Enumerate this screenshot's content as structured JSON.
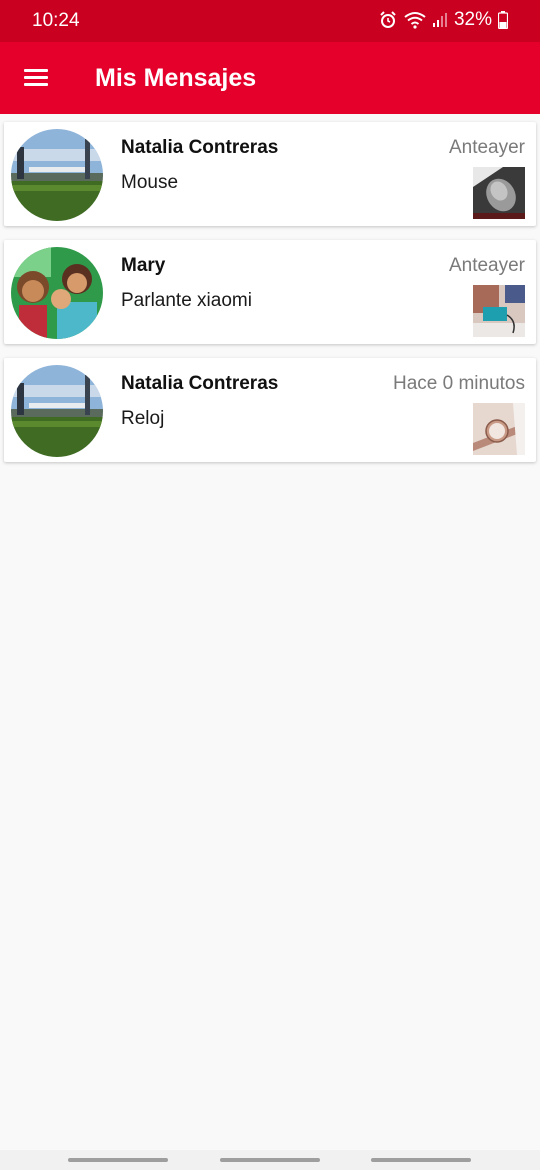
{
  "status": {
    "time": "10:24",
    "battery": "32%",
    "icons": [
      "alarm-icon",
      "wifi-icon",
      "signal-icon",
      "battery-icon"
    ]
  },
  "header": {
    "title": "Mis Mensajes",
    "menu_icon": "hamburger-menu-icon"
  },
  "colors": {
    "primary": "#e4002b",
    "status_bar": "#c9001f",
    "background": "#f9f9f9"
  },
  "conversations": [
    {
      "name": "Natalia Contreras",
      "time": "Anteayer",
      "message": "Mouse",
      "avatar": "avatar-photo-outdoor",
      "thumb": "mouse-product-thumbnail"
    },
    {
      "name": "Mary",
      "time": "Anteayer",
      "message": "Parlante xiaomi",
      "avatar": "avatar-photo-couple",
      "thumb": "speaker-product-thumbnail"
    },
    {
      "name": "Natalia Contreras",
      "time": "Hace 0 minutos",
      "message": "Reloj",
      "avatar": "avatar-photo-outdoor",
      "thumb": "watch-product-thumbnail"
    }
  ]
}
